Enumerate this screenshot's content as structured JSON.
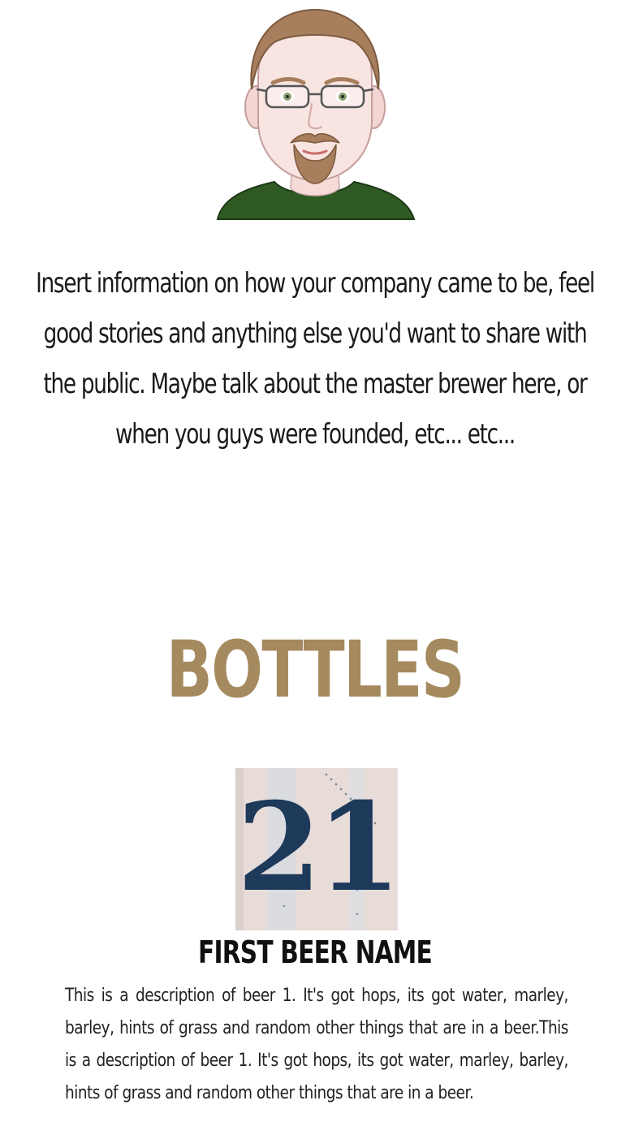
{
  "profile": {
    "avatar_icon": "bearded-man-with-glasses-avatar",
    "shirt_color": "#2f5a23",
    "hair_color": "#a87f5c"
  },
  "intro": {
    "text": "Insert information on how your company came to be, feel good stories and anything else you'd want to share with the public. Maybe talk about the master brewer here, or when you guys were founded, etc... etc..."
  },
  "bottles": {
    "heading": "BOTTLES",
    "heading_color": "#a58a5f",
    "items": [
      {
        "image_icon": "number-21-sign-image",
        "image_text": "21",
        "name": "FIRST BEER NAME",
        "description": "This is a description of beer 1. It's got hops, its got water, marley, barley, hints of grass and random other things that are in a beer.This is a description of beer 1. It's got hops, its got water, marley, barley, hints of grass and random other things that are in a beer."
      }
    ]
  }
}
